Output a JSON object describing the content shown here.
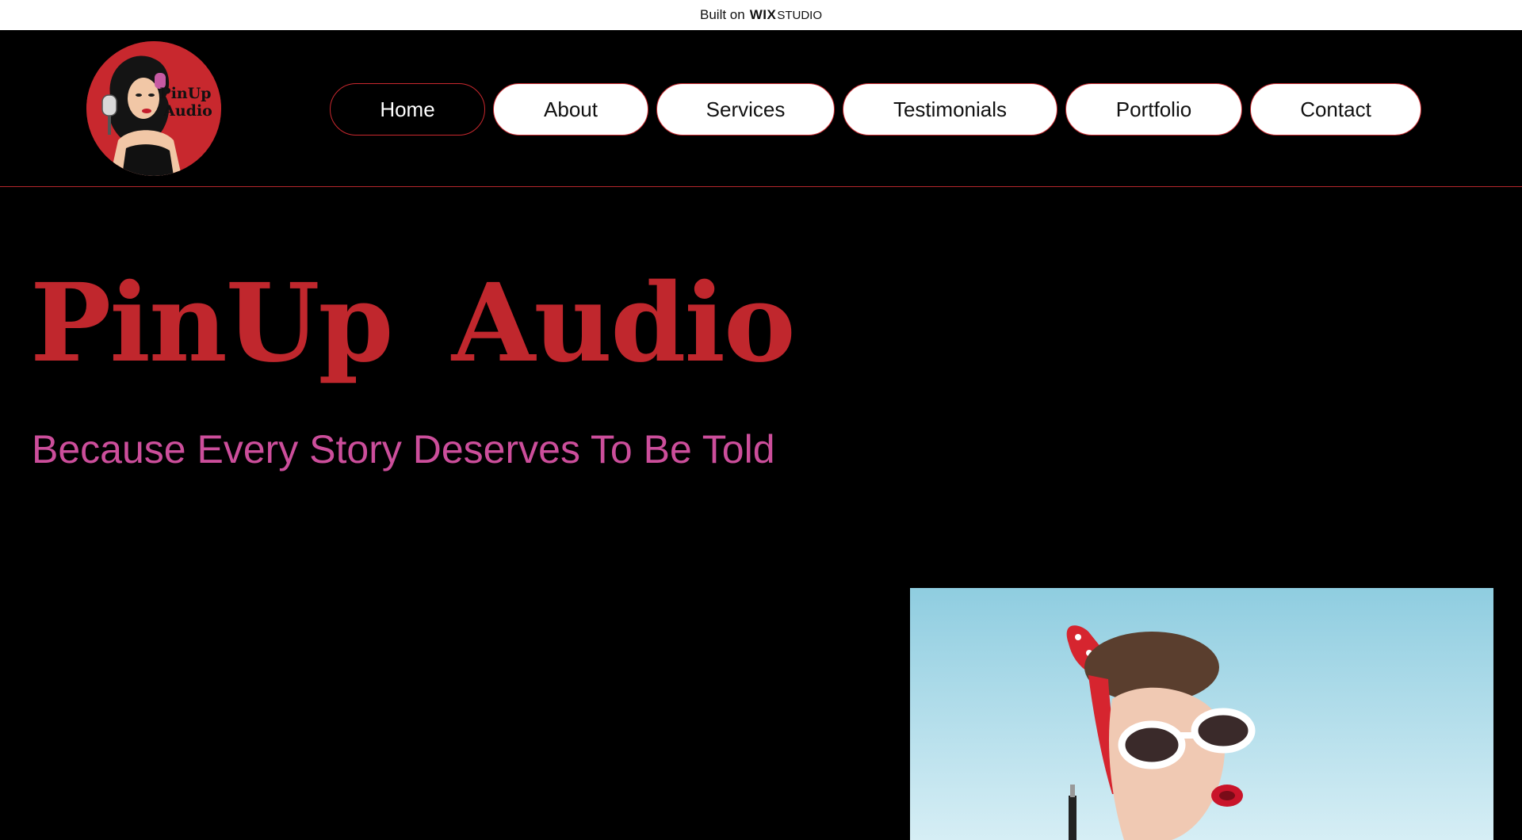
{
  "banner": {
    "prefix": "Built on",
    "brand_bold": "WIX",
    "brand_light": "STUDIO"
  },
  "header": {
    "logo": {
      "line1": "PinUp",
      "line2": "Audio"
    },
    "nav": [
      {
        "label": "Home",
        "active": true
      },
      {
        "label": "About",
        "active": false
      },
      {
        "label": "Services",
        "active": false
      },
      {
        "label": "Testimonials",
        "active": false
      },
      {
        "label": "Portfolio",
        "active": false
      },
      {
        "label": "Contact",
        "active": false
      }
    ]
  },
  "hero": {
    "title": "PinUp Audio",
    "subtitle": "Because Every Story Deserves To Be Told"
  },
  "colors": {
    "accent_red": "#c0272d",
    "subtitle_pink": "#cc4e9b",
    "background": "#000000"
  }
}
